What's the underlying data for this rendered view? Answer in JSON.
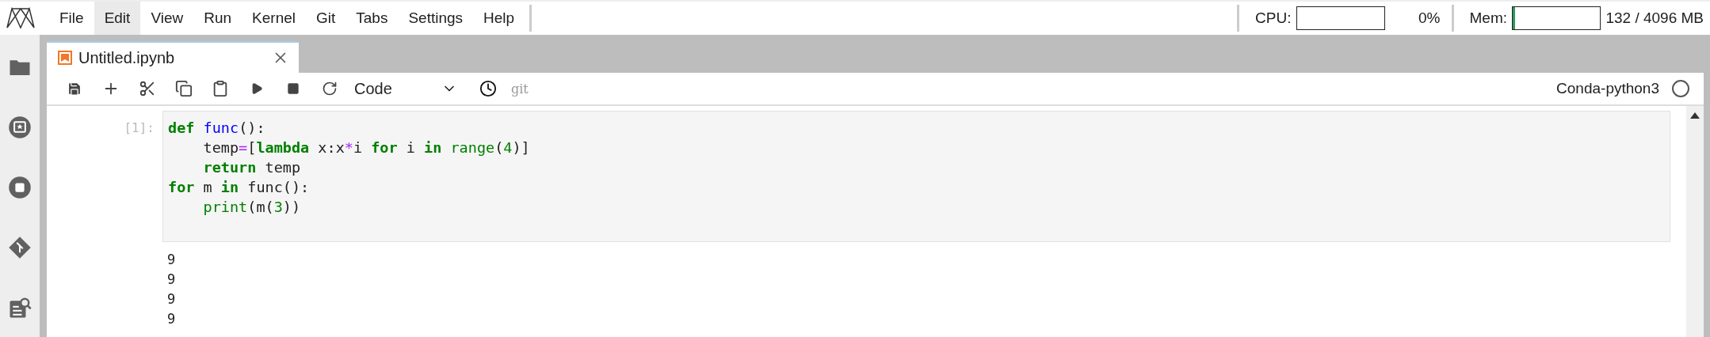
{
  "menu": [
    {
      "label": "File",
      "selected": false
    },
    {
      "label": "Edit",
      "selected": true
    },
    {
      "label": "View",
      "selected": false
    },
    {
      "label": "Run",
      "selected": false
    },
    {
      "label": "Kernel",
      "selected": false
    },
    {
      "label": "Git",
      "selected": false
    },
    {
      "label": "Tabs",
      "selected": false
    },
    {
      "label": "Settings",
      "selected": false
    },
    {
      "label": "Help",
      "selected": false
    }
  ],
  "resources": {
    "cpu": {
      "label": "CPU:",
      "level": 0,
      "reading": "0%"
    },
    "mem": {
      "label": "Mem:",
      "level": 0.03,
      "reading": "132 / 4096 MB"
    }
  },
  "sidebar": [
    {
      "kind": "folder"
    },
    {
      "kind": "running"
    },
    {
      "kind": "stop"
    },
    {
      "kind": "git"
    },
    {
      "kind": "inspector"
    }
  ],
  "tab": {
    "title": "Untitled.ipynb"
  },
  "toolbar": {
    "cell_type": "Code",
    "git_label": "git",
    "kernel": "Conda-python3",
    "kernel_busy": false
  },
  "cell": {
    "prompt": "[1]:",
    "lines": [
      [
        {
          "kind": "keyword",
          "text": "def"
        },
        {
          "kind": "defname",
          "text": " func"
        },
        {
          "kind": "plain",
          "text": "():"
        }
      ],
      [
        {
          "kind": "plain",
          "text": "    temp"
        },
        {
          "kind": "operator",
          "text": "="
        },
        {
          "kind": "plain",
          "text": "["
        },
        {
          "kind": "keyword",
          "text": "lambda"
        },
        {
          "kind": "plain",
          "text": " x:x"
        },
        {
          "kind": "operator",
          "text": "*"
        },
        {
          "kind": "plain",
          "text": "i "
        },
        {
          "kind": "keyword",
          "text": "for"
        },
        {
          "kind": "plain",
          "text": " i "
        },
        {
          "kind": "keyword",
          "text": "in"
        },
        {
          "kind": "builtin",
          "text": " range"
        },
        {
          "kind": "plain",
          "text": "("
        },
        {
          "kind": "number",
          "text": "4"
        },
        {
          "kind": "plain",
          "text": ")]"
        }
      ],
      [
        {
          "kind": "keyword",
          "text": "    return"
        },
        {
          "kind": "plain",
          "text": " temp"
        }
      ],
      [
        {
          "kind": "keyword",
          "text": "for"
        },
        {
          "kind": "plain",
          "text": " m "
        },
        {
          "kind": "keyword",
          "text": "in"
        },
        {
          "kind": "plain",
          "text": " func():"
        }
      ],
      [
        {
          "kind": "builtin",
          "text": "    print"
        },
        {
          "kind": "plain",
          "text": "(m("
        },
        {
          "kind": "number",
          "text": "3"
        },
        {
          "kind": "plain",
          "text": "))"
        }
      ]
    ],
    "output": [
      "9",
      "9",
      "9",
      "9"
    ]
  }
}
